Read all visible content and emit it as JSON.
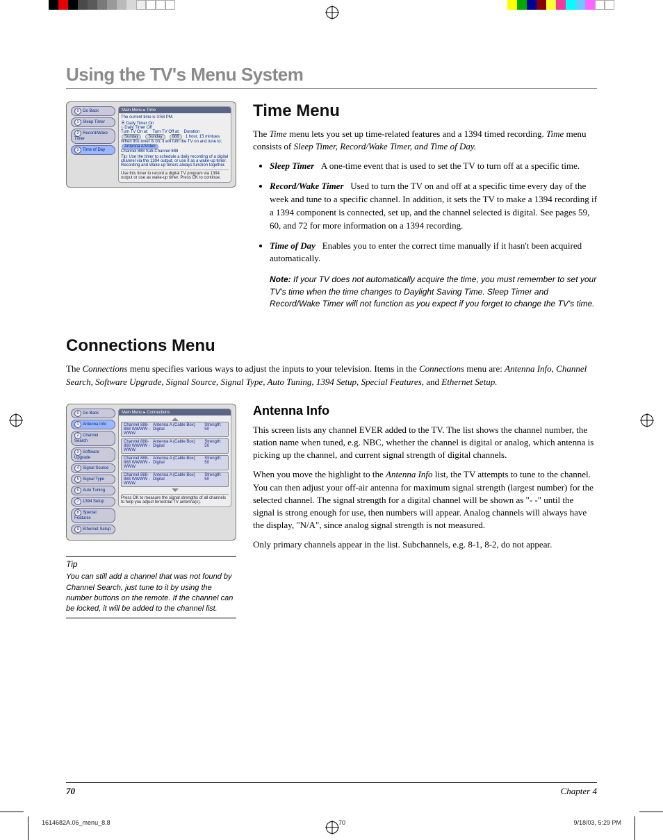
{
  "chapter_title": "Using the TV's Menu System",
  "time_menu": {
    "heading": "Time Menu",
    "intro_1": "The ",
    "intro_em1": "Time",
    "intro_2": " menu lets you set up time-related features and a 1394 timed recording. ",
    "intro_em2": "Time",
    "intro_3": " menu consists of ",
    "intro_em3": "Sleep Timer, Record/Wake Timer, and Time of Day.",
    "items": [
      {
        "term": "Sleep Timer",
        "desc": "A one-time event that is used to set the TV to turn off at a specific time."
      },
      {
        "term": "Record/Wake Timer",
        "desc": "Used to turn the TV on and off at a specific time every day of the week and tune to a specific channel. In addition, it sets the TV to make a 1394 recording if a 1394 component is connected, set up, and the channel selected is digital. See pages 59, 60, and 72 for more information on a 1394 recording."
      },
      {
        "term": "Time of Day",
        "desc": "Enables you to enter the correct time manually if it hasn't been acquired automatically."
      }
    ],
    "note_label": "Note:",
    "note": "If your TV does not automatically acquire the time, you must remember to set your TV's time when the time changes to Daylight Saving Time. Sleep Timer and Record/Wake Timer will not function as you expect if you forget to change the TV's time."
  },
  "connections_menu": {
    "heading": "Connections Menu",
    "intro_1": "The ",
    "intro_em1": "Connections",
    "intro_2": " menu specifies various ways to adjust the inputs to your television. Items in the ",
    "intro_em2": "Connections",
    "intro_3": " menu are: ",
    "intro_em3": "Antenna Info, Channel Search, Software Upgrade, Signal Source, Signal Type, Auto Tuning, 1394 Setup, Special Features,",
    "intro_4": " and ",
    "intro_em4": "Ethernet Setup."
  },
  "antenna_info": {
    "heading": "Antenna Info",
    "p1": "This screen lists any channel EVER added to the TV. The list shows the channel number, the station name when tuned, e.g. NBC, whether the channel is digital or analog, which antenna is picking up the channel, and current signal strength of digital channels.",
    "p2a": "When you move the highlight to the ",
    "p2em": "Antenna Info",
    "p2b": " list, the TV attempts to tune to the channel. You can then adjust your off-air antenna for maximum signal strength (largest number) for the selected channel. The signal strength for a digital channel will be shown as \"- -\" until the signal is strong enough for use, then numbers will appear. Analog channels will always have the display, \"N/A\", since analog signal strength is not measured.",
    "p3": "Only primary channels appear in the list. Subchannels, e.g. 8-1, 8-2, do not appear."
  },
  "tip": {
    "head": "Tip",
    "body": "You can still add a channel that was not found by Channel Search, just tune to it by using the number buttons on the remote. If the channel can be locked, it will be added to the channel list."
  },
  "mock_time": {
    "crumb": "Main Menu ▸ Time",
    "nav": [
      "Go Back",
      "Sleep Timer",
      "Record/Wake Timer",
      "Time of Day"
    ],
    "line1": "The current time is 3:58 PM.",
    "line2": "Daily Timer On",
    "line3": "Daily Timer Off",
    "hdr": [
      "Turn TV On at:",
      "Turn TV Off at:",
      "Duration"
    ],
    "vals": [
      "Sunday",
      "Sunday",
      "1 hour, 15 mintues"
    ],
    "line4": "When this timer is on, it will turn the TV on and tune to:",
    "ant": "Antenna A/Video",
    "ch": "Channel  888   Sub-Channel  888",
    "tip": "Tip: Use the timer to schedule a daily recording  of a digital channel via the 1394 output, or use it as a wake-up timer. Recording and Wake-up timers always function together.",
    "hint": "Use this timer to record a digital TV program via 1394 output or use as wake-up timer. Press OK to continue."
  },
  "mock_conn": {
    "crumb": "Main Menu ▸ Connections",
    "nav": [
      "Go Back",
      "Antenna Info",
      "Channel Search",
      "Software Upgrade",
      "Signal Source",
      "Signal Type",
      "Auto Tuning",
      "1394 Setup",
      "Special Features",
      "Ethernet Setup"
    ],
    "row_ch": "Channel 888-888 WWWW - WWW",
    "row_ant": "Antenna A (Cable Box) Digital",
    "row_str": "Strength: 50",
    "hint": "Press OK to measure the signal strengths of all channels to help you adjust terrestrial TV antenna(s)."
  },
  "footer": {
    "page": "70",
    "chap": "Chapter 4"
  },
  "meta": {
    "file": "1614682A.06_menu_8.8",
    "pg": "70",
    "date": "9/18/03, 5:29 PM"
  }
}
